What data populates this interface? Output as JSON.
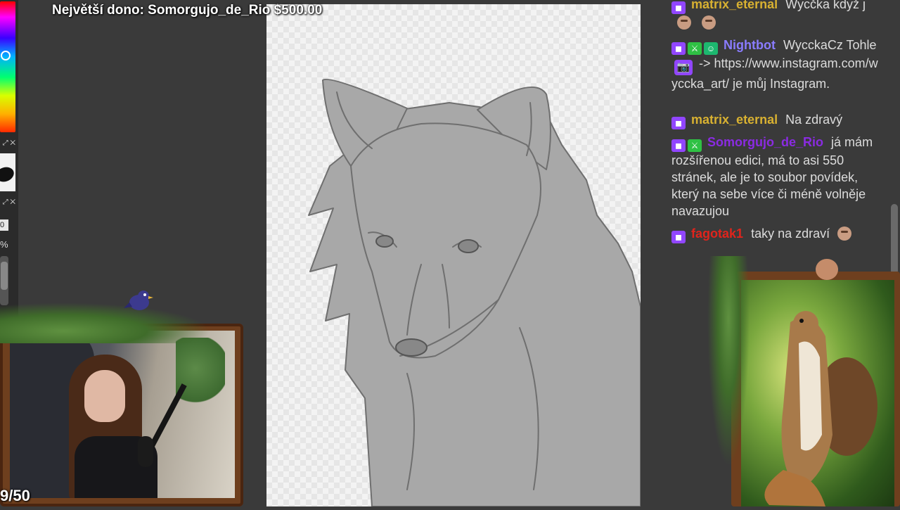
{
  "overlay": {
    "top_donor": "Největší dono: Somorgujo_de_Rio $500.00",
    "goal_counter": "9/50"
  },
  "app": {
    "size_field": "0",
    "opacity_label": "%"
  },
  "chat": {
    "messages": [
      {
        "user": "matrix_eternal",
        "user_color": "#d8b131",
        "badges": [
          "sub"
        ],
        "text": "Wycčka když j",
        "emotes": [
          "peepo-emote",
          "peepo-emote"
        ]
      },
      {
        "user": "Nightbot",
        "user_color": "#8a7cff",
        "badges": [
          "sub",
          "sword",
          "bot"
        ],
        "text_parts": [
          "WycckaCz Tohle",
          "-> https://www.instagram.com/wyccka_art/ je můj Instagram."
        ],
        "emote": "camera-emote"
      },
      {
        "user": "matrix_eternal",
        "user_color": "#d8b131",
        "badges": [
          "sub"
        ],
        "text": "Na zdravý"
      },
      {
        "user": "Somorgujo_de_Rio",
        "user_color": "#8a2be2",
        "badges": [
          "sub",
          "sword"
        ],
        "text": "já mám rozšířenou edici, má to asi 550 stránek, ale je to soubor povídek, který na sebe více či méně volněje navazujou"
      },
      {
        "user": "fagotak1",
        "user_color": "#e0241c",
        "badges": [
          "sub"
        ],
        "text": "taky na zdraví",
        "emote": "face-emote"
      }
    ]
  },
  "colors": {
    "background": "#3a3a3a",
    "canvas": "#f3f3f3",
    "sketch": "#6f6f6f",
    "wood_frame": "#6e3f1e",
    "twitch_purple": "#9146ff"
  }
}
